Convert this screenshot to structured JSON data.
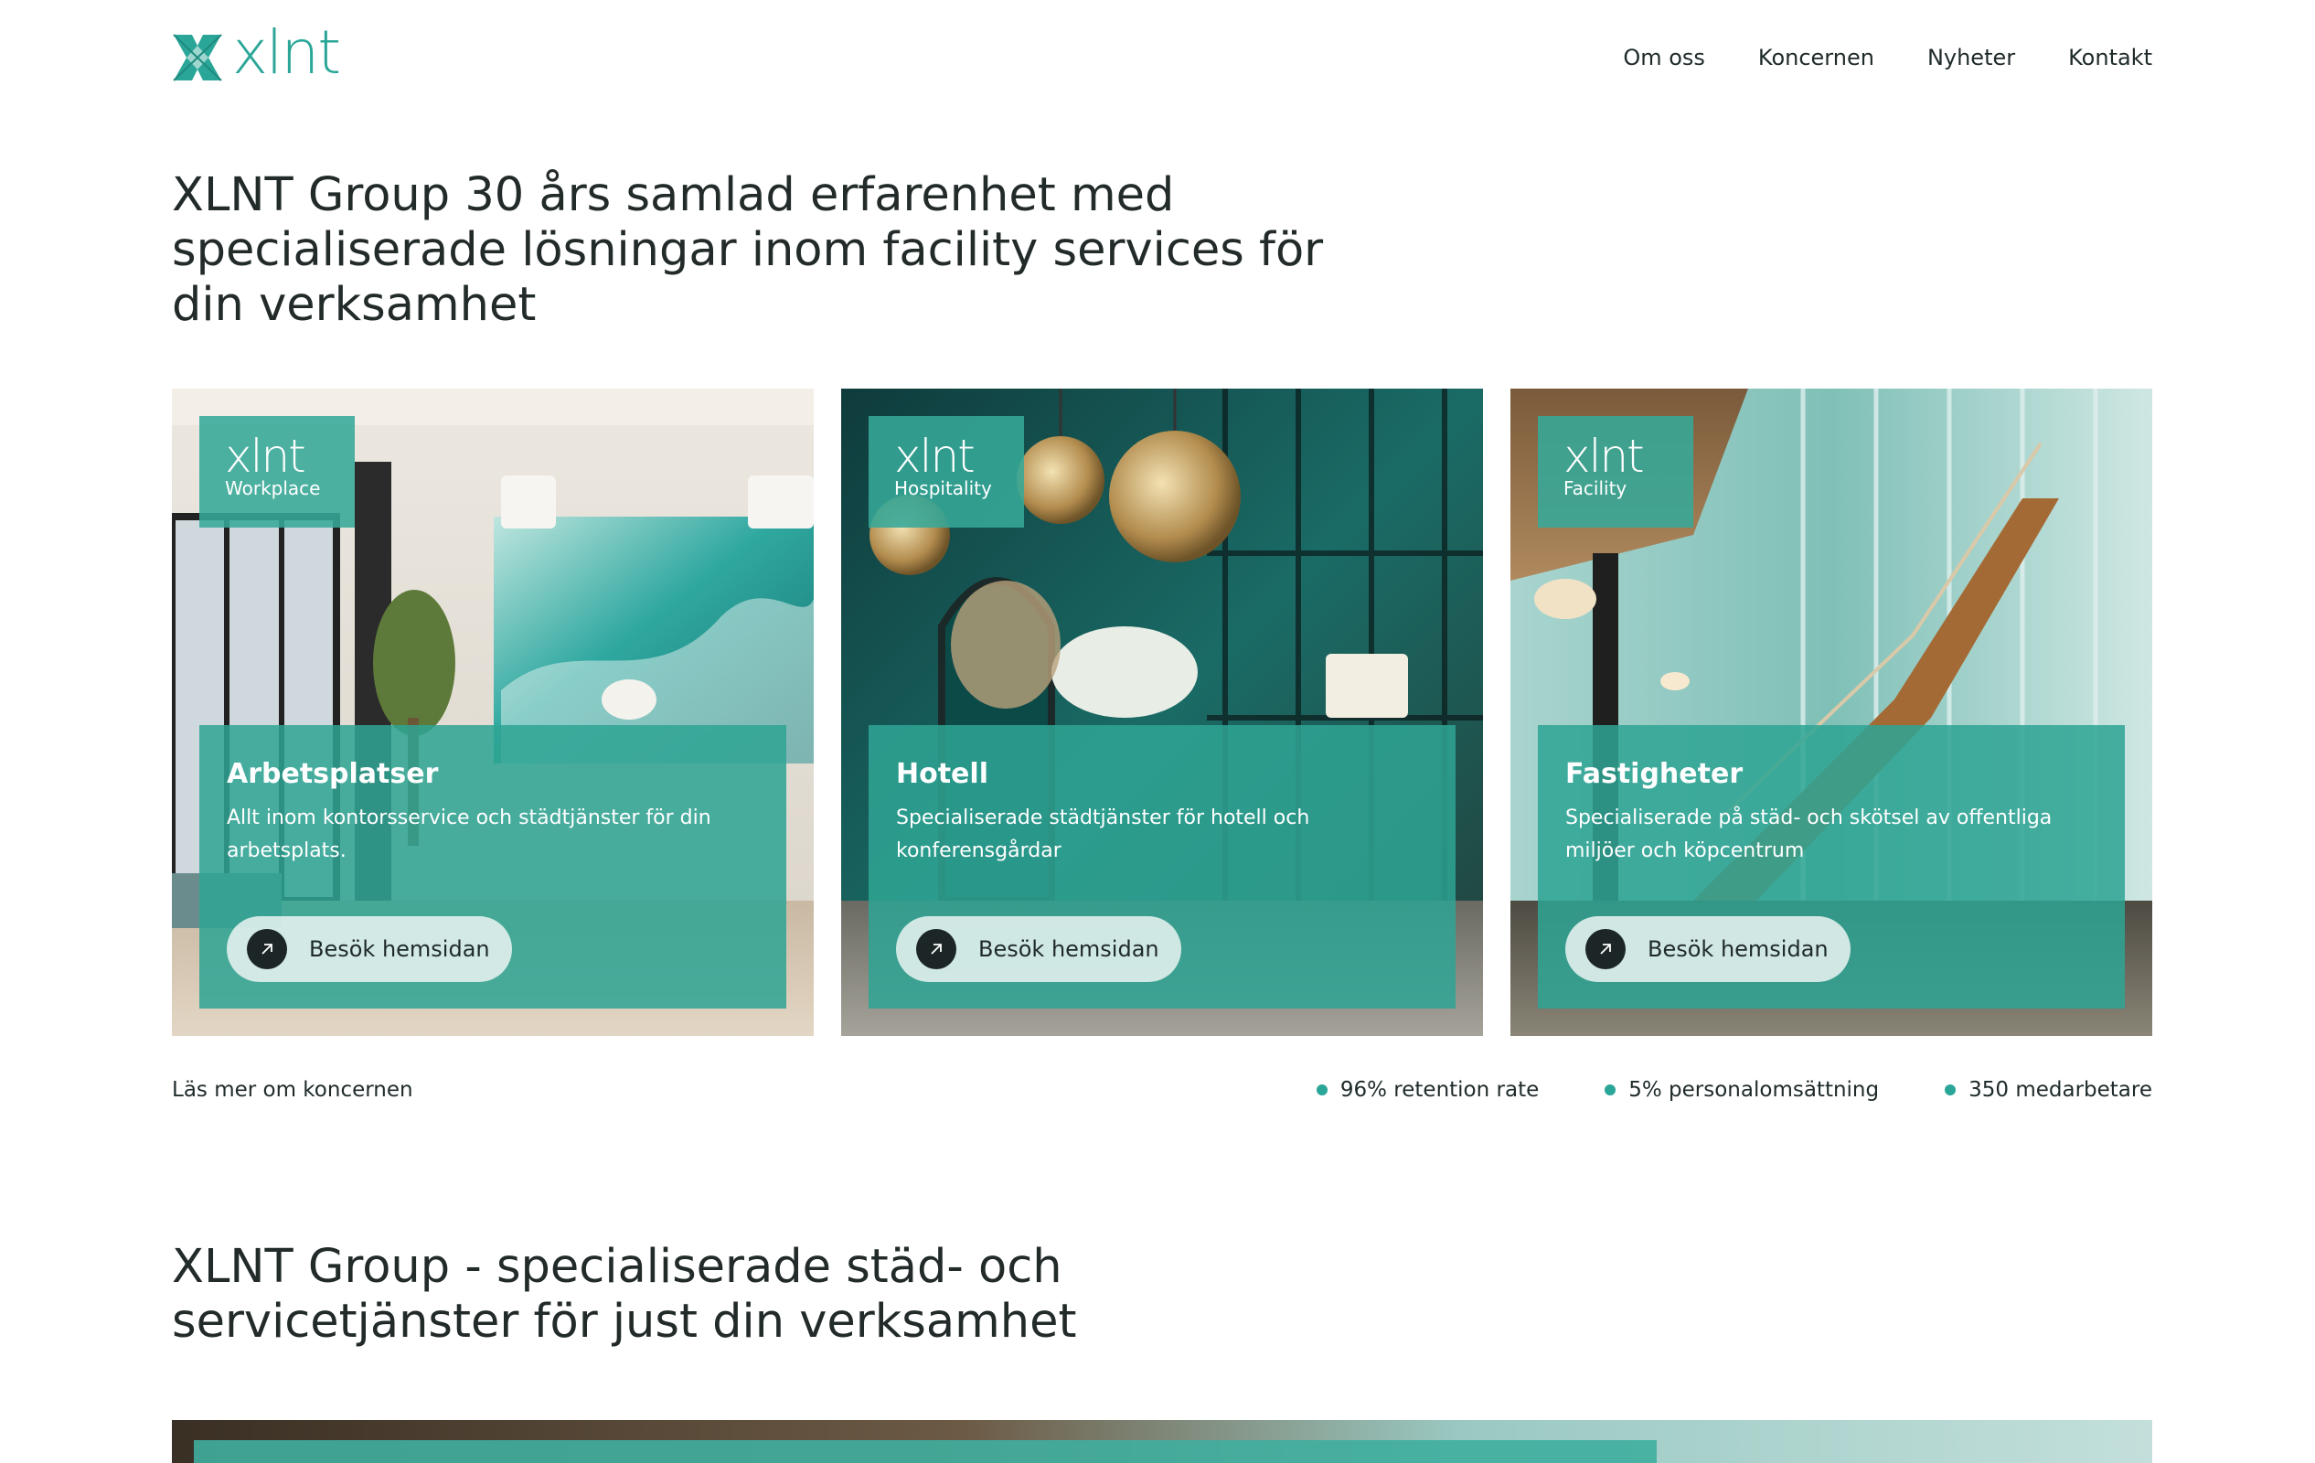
{
  "brand": {
    "logo_text": "xlnt",
    "accent": "#2aa698"
  },
  "nav": {
    "items": [
      {
        "label": "Om oss"
      },
      {
        "label": "Koncernen"
      },
      {
        "label": "Nyheter"
      },
      {
        "label": "Kontakt"
      }
    ]
  },
  "hero": {
    "title": "XLNT Group 30 års samlad erfarenhet med specialiserade lösningar inom facility services för din verksamhet"
  },
  "cards": [
    {
      "badge_logo": "xlnt",
      "badge_sub": "Workplace",
      "title": "Arbetsplatser",
      "description": "Allt inom kontorsservice och städtjänster för din arbetsplats.",
      "button": "Besök hemsidan"
    },
    {
      "badge_logo": "xlnt",
      "badge_sub": "Hospitality",
      "title": "Hotell",
      "description": "Specialiserade städtjänster för hotell och konferensgårdar",
      "button": "Besök hemsidan"
    },
    {
      "badge_logo": "xlnt",
      "badge_sub": "Facility",
      "title": "Fastigheter",
      "description": "Specialiserade på städ- och skötsel av offentliga miljöer och köpcentrum",
      "button": "Besök hemsidan"
    }
  ],
  "read_more": "Läs mer om koncernen",
  "stats": [
    {
      "text": "96% retention rate"
    },
    {
      "text": "5% personalomsättning"
    },
    {
      "text": "350 medarbetare"
    }
  ],
  "section2": {
    "title": "XLNT Group - specialiserade städ- och servicetjänster för just din verksamhet"
  }
}
